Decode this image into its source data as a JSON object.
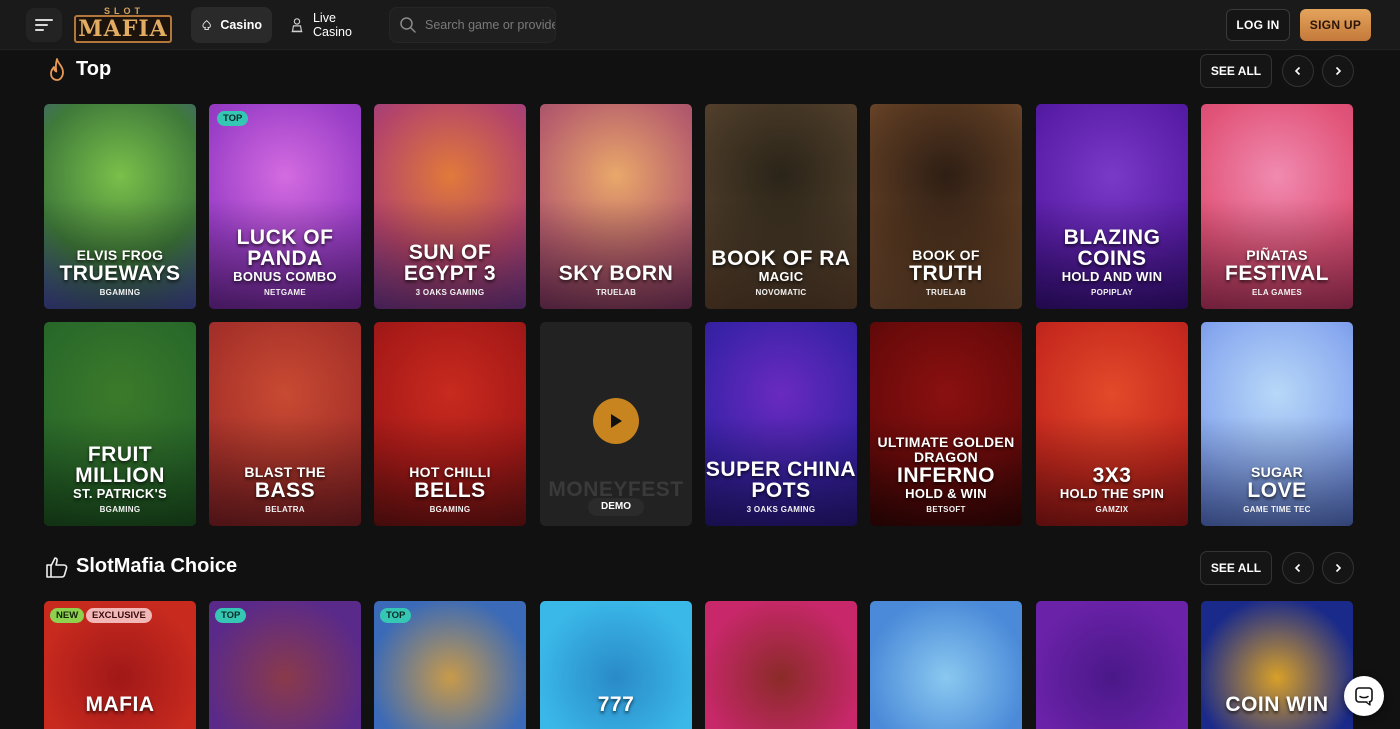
{
  "header": {
    "logo_top": "SLOT",
    "logo_main": "MAFIA",
    "nav": [
      {
        "label": "Casino",
        "icon": "spade-icon",
        "active": true
      },
      {
        "label": "Live Casino",
        "icon": "dealer-icon",
        "active": false
      }
    ],
    "search_placeholder": "Search game or provider",
    "login_label": "LOG IN",
    "signup_label": "SIGN UP"
  },
  "sections": [
    {
      "title": "Top",
      "icon": "flame-icon",
      "see_all": "SEE ALL"
    },
    {
      "title": "SlotMafia Choice",
      "icon": "thumbs-up-icon",
      "see_all": "SEE ALL"
    }
  ],
  "top_row1": [
    {
      "t1": "ELVIS FROG",
      "t2": "TRUEWAYS",
      "t3": "",
      "provider": "BGAMING",
      "badge": "",
      "colors": [
        "#7ac04a",
        "#3f7a3a",
        "#4a4fb0"
      ]
    },
    {
      "t1": "",
      "t2": "LUCK OF PANDA",
      "t3": "BONUS COMBO",
      "provider": "NETGAME",
      "badge": "TOP",
      "colors": [
        "#d46be0",
        "#9b3fc8",
        "#7a2aa8"
      ]
    },
    {
      "t1": "",
      "t2": "SUN OF EGYPT 3",
      "t3": "",
      "provider": "3 OAKS GAMING",
      "badge": "",
      "colors": [
        "#e07a3a",
        "#b4446a",
        "#7a3a9a"
      ]
    },
    {
      "t1": "",
      "t2": "SKY BORN",
      "t3": "",
      "provider": "TRUELAB",
      "badge": "",
      "colors": [
        "#e9a86a",
        "#b8606c",
        "#8a3a6a"
      ]
    },
    {
      "t1": "",
      "t2": "BOOK OF RA",
      "t3": "MAGIC",
      "provider": "NOVOMATIC",
      "badge": "",
      "colors": [
        "#2a2418",
        "#4a3a28",
        "#6a4a32"
      ]
    },
    {
      "t1": "BOOK OF",
      "t2": "TRUTH",
      "t3": "",
      "provider": "TRUELAB",
      "badge": "",
      "colors": [
        "#2e1e14",
        "#5a3a22",
        "#8a5a3a"
      ]
    },
    {
      "t1": "",
      "t2": "BLAZING COINS",
      "t3": "HOLD AND WIN",
      "provider": "POPIPLAY",
      "badge": "",
      "colors": [
        "#7a3ac8",
        "#5a1ea8",
        "#3a1088"
      ]
    },
    {
      "t1": "PIÑATAS",
      "t2": "FESTIVAL",
      "t3": "",
      "provider": "ELA GAMES",
      "badge": "",
      "colors": [
        "#f08ab0",
        "#e2557a",
        "#c8386a"
      ]
    }
  ],
  "top_row2": [
    {
      "t1": "",
      "t2": "FRUIT MILLION",
      "t3": "ST. PATRICK'S",
      "provider": "BGAMING",
      "badge": "",
      "colors": [
        "#3c7a2a",
        "#2a6a2a",
        "#1e5a22"
      ]
    },
    {
      "t1": "BLAST THE",
      "t2": "BASS",
      "t3": "",
      "provider": "BELATRA",
      "badge": "",
      "colors": [
        "#c84a32",
        "#a8322a",
        "#8a2228"
      ]
    },
    {
      "t1": "HOT CHILLI",
      "t2": "BELLS",
      "t3": "",
      "provider": "BGAMING",
      "badge": "",
      "colors": [
        "#c82a1e",
        "#a81a18",
        "#7a1414"
      ]
    },
    {
      "t1": "",
      "t2": "MONEYFEST",
      "t3": "",
      "provider": "",
      "badge": "",
      "demo": "DEMO",
      "colors": [
        "#222222",
        "#222222",
        "#222222"
      ]
    },
    {
      "t1": "",
      "t2": "SUPER CHINA POTS",
      "t3": "",
      "provider": "3 OAKS GAMING",
      "badge": "",
      "colors": [
        "#6a2ac0",
        "#3a22a8",
        "#2a1a88"
      ]
    },
    {
      "t1": "ULTIMATE GOLDEN DRAGON",
      "t2": "INFERNO",
      "t3": "HOLD & WIN",
      "provider": "BETSOFT",
      "badge": "",
      "colors": [
        "#8a1010",
        "#6a0a0a",
        "#3a0606"
      ]
    },
    {
      "t1": "",
      "t2": "3X3",
      "t3": "HOLD THE SPIN",
      "provider": "GAMZIX",
      "badge": "",
      "colors": [
        "#e24a2a",
        "#c82a1e",
        "#a01818"
      ]
    },
    {
      "t1": "SUGAR",
      "t2": "LOVE",
      "t3": "",
      "provider": "GAME TIME TEC",
      "badge": "",
      "colors": [
        "#b8d8f8",
        "#8aaaf0",
        "#5a78d8"
      ]
    }
  ],
  "choice_row": [
    {
      "badges": [
        "NEW",
        "EXCLUSIVE"
      ],
      "text": "MAFIA",
      "colors": [
        "#c82a1e",
        "#a01818"
      ]
    },
    {
      "badges": [
        "TOP"
      ],
      "text": "",
      "colors": [
        "#5a2a8a",
        "#8a3a4a"
      ]
    },
    {
      "badges": [
        "TOP"
      ],
      "text": "",
      "colors": [
        "#3a6ab8",
        "#c89a4a"
      ]
    },
    {
      "badges": [],
      "text": "777",
      "colors": [
        "#3ab8e8",
        "#2a8ac8"
      ]
    },
    {
      "badges": [],
      "text": "",
      "colors": [
        "#c8286a",
        "#8a2a28"
      ]
    },
    {
      "badges": [],
      "text": "",
      "colors": [
        "#4a8ad8",
        "#8ac8f0"
      ]
    },
    {
      "badges": [],
      "text": "",
      "colors": [
        "#6a22a8",
        "#4a1888"
      ]
    },
    {
      "badges": [],
      "text": "COIN WIN",
      "colors": [
        "#1a2a8a",
        "#d8a028"
      ]
    }
  ]
}
